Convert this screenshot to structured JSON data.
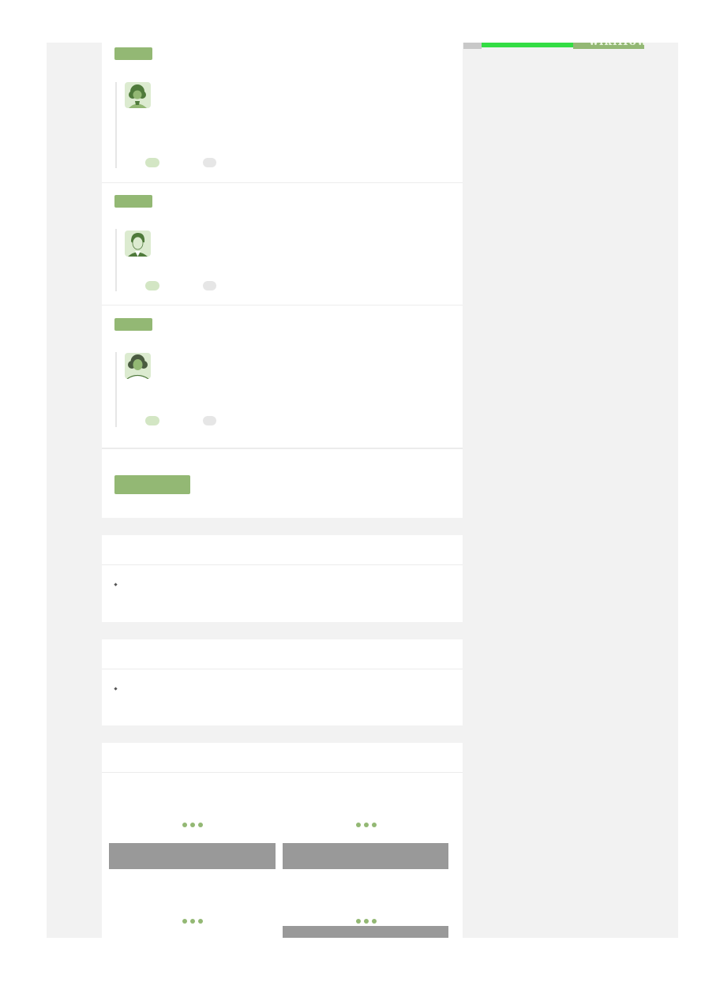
{
  "colors": {
    "accent": "#93b874",
    "accent_light": "#d3e6c4",
    "avatar_bg": "#dcebd0",
    "panel_bg": "#f2f2f2",
    "placeholder_gray": "#999999",
    "ad_green": "#33dd44"
  },
  "qa": {
    "questions": [
      {
        "avatar": "curly-hair-woman-avatar-icon"
      },
      {
        "avatar": "short-hair-person-avatar-icon"
      },
      {
        "avatar": "woman-avatar-icon"
      }
    ]
  },
  "ad_banner": {
    "text": "wikiHow"
  },
  "related": {
    "loading_icon": "ellipsis-loading-icon"
  }
}
